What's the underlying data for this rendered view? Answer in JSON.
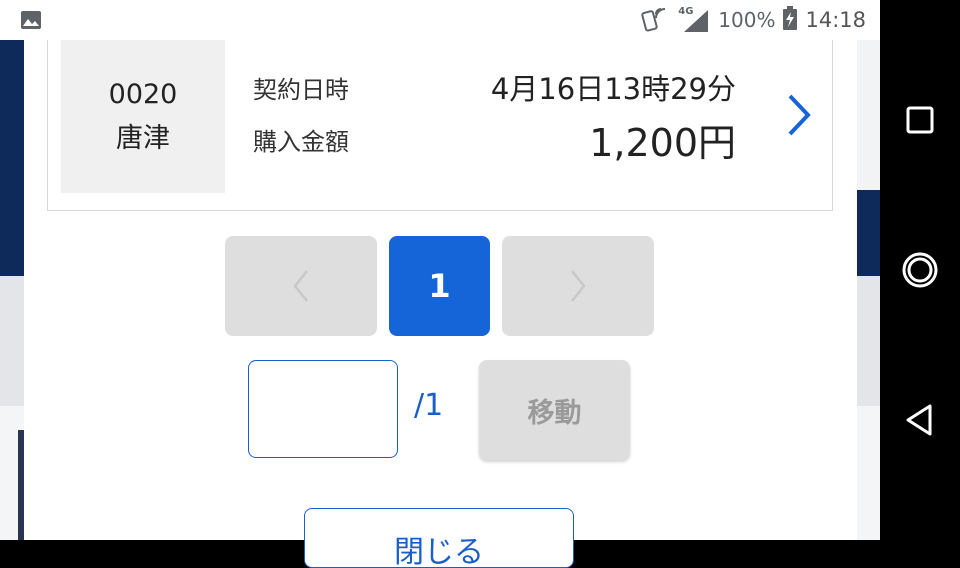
{
  "status_bar": {
    "signal_label": "4G",
    "battery": "100%",
    "time": "14:18"
  },
  "record": {
    "store_code": "0020",
    "store_name": "唐津",
    "contract_label": "契約日時",
    "amount_label": "購入金額",
    "contract_datetime": "4月16日13時29分",
    "purchase_amount": "1,200円"
  },
  "pagination": {
    "current_page": "1",
    "prev_symbol": "‹",
    "next_symbol": "›"
  },
  "jump": {
    "input_value": "",
    "total_pages": "/1",
    "move_label": "移動"
  },
  "bottom_button": {
    "label": "閉じる"
  },
  "colors": {
    "accent": "#1565d8",
    "disabled": "#dedede",
    "chevron": "#1565d8"
  },
  "icons": [
    "gallery-icon",
    "nfc-icon",
    "signal-icon",
    "battery-icon",
    "chevron-right-icon",
    "square-icon",
    "circle-icon",
    "back-triangle-icon"
  ]
}
